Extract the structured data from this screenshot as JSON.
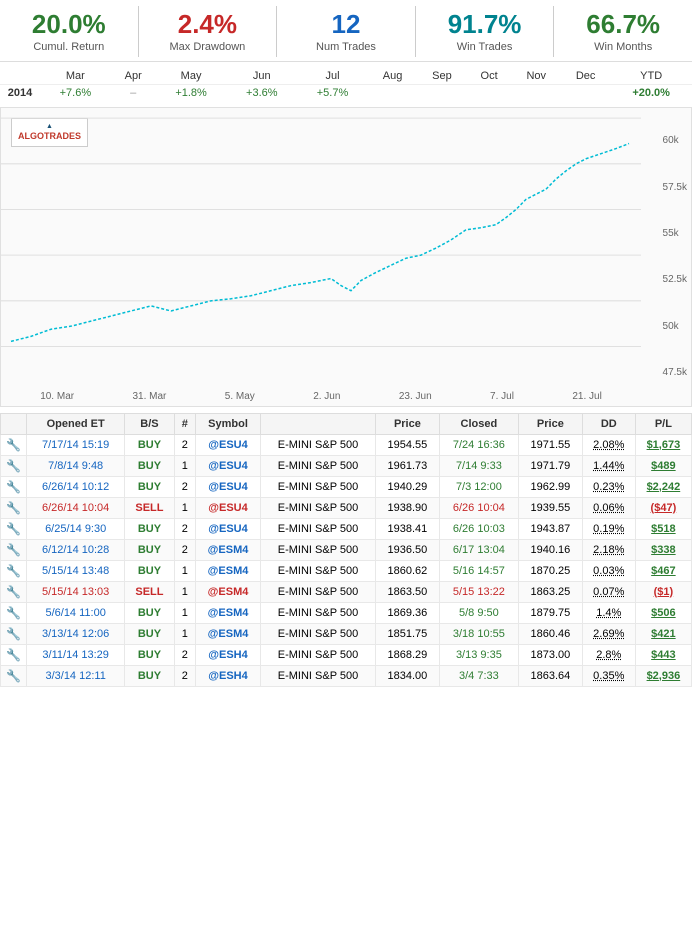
{
  "stats": [
    {
      "id": "cumul-return",
      "value": "20.0%",
      "label": "Cumul. Return",
      "color": "green"
    },
    {
      "id": "max-drawdown",
      "value": "2.4%",
      "label": "Max Drawdown",
      "color": "red"
    },
    {
      "id": "num-trades",
      "value": "12",
      "label": "Num Trades",
      "color": "blue"
    },
    {
      "id": "win-trades",
      "value": "91.7%",
      "label": "Win Trades",
      "color": "teal"
    },
    {
      "id": "win-months",
      "value": "66.7%",
      "label": "Win Months",
      "color": "green"
    }
  ],
  "monthly": {
    "headers": [
      "",
      "Mar",
      "Apr",
      "May",
      "Jun",
      "Jul",
      "Aug",
      "Sep",
      "Oct",
      "Nov",
      "Dec",
      "YTD"
    ],
    "rows": [
      {
        "year": "2014",
        "values": [
          "+7.6%",
          "–",
          "+1.8%",
          "+3.6%",
          "+5.7%",
          "",
          "",
          "",
          "",
          "",
          "+20.0%"
        ],
        "ytd_special": true
      }
    ]
  },
  "chart": {
    "logo_top": "▲",
    "logo_bottom": "ALGOTRADES",
    "y_labels": [
      "60k",
      "57.5k",
      "55k",
      "52.5k",
      "50k",
      "47.5k"
    ],
    "x_labels": [
      "10. Mar",
      "31. Mar",
      "5. May",
      "2. Jun",
      "23. Jun",
      "7. Jul",
      "21. Jul"
    ]
  },
  "trades": {
    "headers": [
      "",
      "Opened ET",
      "B/S",
      "#",
      "Symbol",
      "",
      "Price",
      "Closed",
      "Price",
      "DD",
      "P/L"
    ],
    "rows": [
      {
        "icon": "🔧",
        "opened": "7/17/14 15:19",
        "bs": "BUY",
        "num": "2",
        "symbol": "@ESU4",
        "name": "E-MINI S&P 500",
        "price": "1954.55",
        "closed": "7/24 16:36",
        "closed_price": "1971.55",
        "dd": "2.08%",
        "pl": "$1,673",
        "row_type": "normal"
      },
      {
        "icon": "🔧",
        "opened": "7/8/14 9:48",
        "bs": "BUY",
        "num": "1",
        "symbol": "@ESU4",
        "name": "E-MINI S&P 500",
        "price": "1961.73",
        "closed": "7/14 9:33",
        "closed_price": "1971.79",
        "dd": "1.44%",
        "pl": "$489",
        "row_type": "normal"
      },
      {
        "icon": "🔧",
        "opened": "6/26/14 10:12",
        "bs": "BUY",
        "num": "2",
        "symbol": "@ESU4",
        "name": "E-MINI S&P 500",
        "price": "1940.29",
        "closed": "7/3 12:00",
        "closed_price": "1962.99",
        "dd": "0.23%",
        "pl": "$2,242",
        "row_type": "normal"
      },
      {
        "icon": "🔧",
        "opened": "6/26/14 10:04",
        "bs": "SELL",
        "num": "1",
        "symbol": "@ESU4",
        "name": "E-MINI S&P 500",
        "price": "1938.90",
        "closed": "6/26 10:04",
        "closed_price": "1939.55",
        "dd": "0.06%",
        "pl": "($47)",
        "row_type": "sell"
      },
      {
        "icon": "🔧",
        "opened": "6/25/14 9:30",
        "bs": "BUY",
        "num": "2",
        "symbol": "@ESU4",
        "name": "E-MINI S&P 500",
        "price": "1938.41",
        "closed": "6/26 10:03",
        "closed_price": "1943.87",
        "dd": "0.19%",
        "pl": "$518",
        "row_type": "normal"
      },
      {
        "icon": "🔧",
        "opened": "6/12/14 10:28",
        "bs": "BUY",
        "num": "2",
        "symbol": "@ESM4",
        "name": "E-MINI S&P 500",
        "price": "1936.50",
        "closed": "6/17 13:04",
        "closed_price": "1940.16",
        "dd": "2.18%",
        "pl": "$338",
        "row_type": "normal"
      },
      {
        "icon": "🔧",
        "opened": "5/15/14 13:48",
        "bs": "BUY",
        "num": "1",
        "symbol": "@ESM4",
        "name": "E-MINI S&P 500",
        "price": "1860.62",
        "closed": "5/16 14:57",
        "closed_price": "1870.25",
        "dd": "0.03%",
        "pl": "$467",
        "row_type": "normal"
      },
      {
        "icon": "🔧",
        "opened": "5/15/14 13:03",
        "bs": "SELL",
        "num": "1",
        "symbol": "@ESM4",
        "name": "E-MINI S&P 500",
        "price": "1863.50",
        "closed": "5/15 13:22",
        "closed_price": "1863.25",
        "dd": "0.07%",
        "pl": "($1)",
        "row_type": "sell"
      },
      {
        "icon": "🔧",
        "opened": "5/6/14 11:00",
        "bs": "BUY",
        "num": "1",
        "symbol": "@ESM4",
        "name": "E-MINI S&P 500",
        "price": "1869.36",
        "closed": "5/8 9:50",
        "closed_price": "1879.75",
        "dd": "1.4%",
        "pl": "$506",
        "row_type": "normal"
      },
      {
        "icon": "🔧",
        "opened": "3/13/14 12:06",
        "bs": "BUY",
        "num": "1",
        "symbol": "@ESM4",
        "name": "E-MINI S&P 500",
        "price": "1851.75",
        "closed": "3/18 10:55",
        "closed_price": "1860.46",
        "dd": "2.69%",
        "pl": "$421",
        "row_type": "normal"
      },
      {
        "icon": "🔧",
        "opened": "3/11/14 13:29",
        "bs": "BUY",
        "num": "2",
        "symbol": "@ESH4",
        "name": "E-MINI S&P 500",
        "price": "1868.29",
        "closed": "3/13 9:35",
        "closed_price": "1873.00",
        "dd": "2.8%",
        "pl": "$443",
        "row_type": "normal"
      },
      {
        "icon": "🔧",
        "opened": "3/3/14 12:11",
        "bs": "BUY",
        "num": "2",
        "symbol": "@ESH4",
        "name": "E-MINI S&P 500",
        "price": "1834.00",
        "closed": "3/4 7:33",
        "closed_price": "1863.64",
        "dd": "0.35%",
        "pl": "$2,936",
        "row_type": "normal"
      }
    ]
  }
}
